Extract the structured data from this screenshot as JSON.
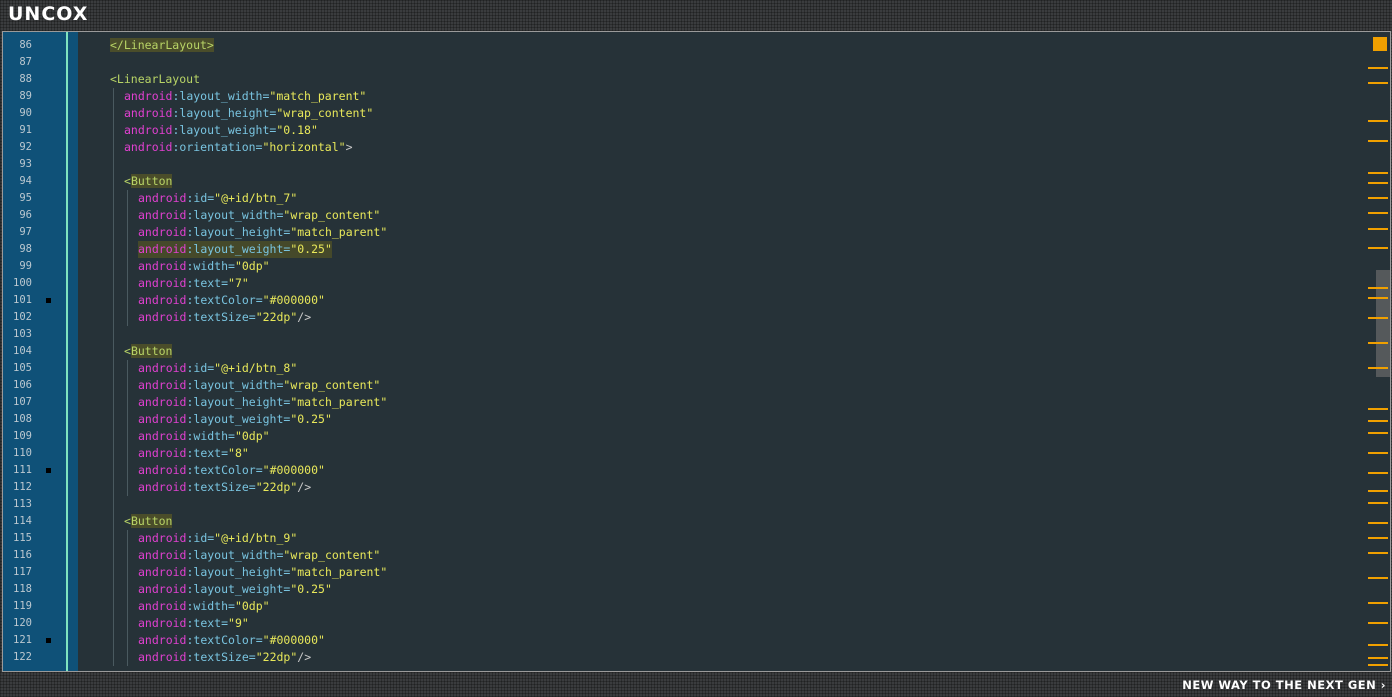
{
  "app": {
    "logo": "UNCOX",
    "tagline": "NEW WAY TO THE NEXT GEN ›"
  },
  "editor": {
    "breakpoint_lines": [
      101,
      111,
      121
    ],
    "lines": [
      {
        "n": "86",
        "indent": 0,
        "tokens": [
          {
            "t": "</LinearLayout>",
            "c": "tt",
            "hl": true
          }
        ]
      },
      {
        "n": "87",
        "indent": 0,
        "tokens": []
      },
      {
        "n": "88",
        "indent": 0,
        "tokens": [
          {
            "t": "<LinearLayout",
            "c": "tt"
          }
        ]
      },
      {
        "n": "89",
        "indent": 1,
        "tokens": [
          {
            "t": "android",
            "c": "ta"
          },
          {
            "t": ":layout_width=",
            "c": "tb"
          },
          {
            "t": "\"match_parent\"",
            "c": "tv"
          }
        ]
      },
      {
        "n": "90",
        "indent": 1,
        "tokens": [
          {
            "t": "android",
            "c": "ta"
          },
          {
            "t": ":layout_height=",
            "c": "tb"
          },
          {
            "t": "\"wrap_content\"",
            "c": "tv"
          }
        ]
      },
      {
        "n": "91",
        "indent": 1,
        "tokens": [
          {
            "t": "android",
            "c": "ta"
          },
          {
            "t": ":layout_weight=",
            "c": "tb"
          },
          {
            "t": "\"0.18\"",
            "c": "tv"
          }
        ]
      },
      {
        "n": "92",
        "indent": 1,
        "tokens": [
          {
            "t": "android",
            "c": "ta"
          },
          {
            "t": ":orientation=",
            "c": "tb"
          },
          {
            "t": "\"horizontal\"",
            "c": "tv"
          },
          {
            "t": ">",
            "c": "tp"
          }
        ]
      },
      {
        "n": "93",
        "indent": 1,
        "tokens": []
      },
      {
        "n": "94",
        "indent": 1,
        "tokens": [
          {
            "t": "<",
            "c": "tt"
          },
          {
            "t": "Button",
            "c": "tt",
            "hl": true
          }
        ]
      },
      {
        "n": "95",
        "indent": 2,
        "tokens": [
          {
            "t": "android",
            "c": "ta"
          },
          {
            "t": ":id=",
            "c": "tb"
          },
          {
            "t": "\"@+id/btn_7\"",
            "c": "tv"
          }
        ]
      },
      {
        "n": "96",
        "indent": 2,
        "tokens": [
          {
            "t": "android",
            "c": "ta"
          },
          {
            "t": ":layout_width=",
            "c": "tb"
          },
          {
            "t": "\"wrap_content\"",
            "c": "tv"
          }
        ]
      },
      {
        "n": "97",
        "indent": 2,
        "tokens": [
          {
            "t": "android",
            "c": "ta"
          },
          {
            "t": ":layout_height=",
            "c": "tb"
          },
          {
            "t": "\"match_parent\"",
            "c": "tv"
          }
        ]
      },
      {
        "n": "98",
        "indent": 2,
        "rowhl": true,
        "tokens": [
          {
            "t": "android",
            "c": "ta"
          },
          {
            "t": ":layout_weight=",
            "c": "tb"
          },
          {
            "t": "\"0.25\"",
            "c": "tv"
          }
        ]
      },
      {
        "n": "99",
        "indent": 2,
        "tokens": [
          {
            "t": "android",
            "c": "ta"
          },
          {
            "t": ":width=",
            "c": "tb"
          },
          {
            "t": "\"0dp\"",
            "c": "tv"
          }
        ]
      },
      {
        "n": "100",
        "indent": 2,
        "tokens": [
          {
            "t": "android",
            "c": "ta"
          },
          {
            "t": ":text=",
            "c": "tb"
          },
          {
            "t": "\"7\"",
            "c": "tv"
          }
        ]
      },
      {
        "n": "101",
        "indent": 2,
        "tokens": [
          {
            "t": "android",
            "c": "ta"
          },
          {
            "t": ":textColor=",
            "c": "tb"
          },
          {
            "t": "\"#000000\"",
            "c": "tv"
          }
        ]
      },
      {
        "n": "102",
        "indent": 2,
        "tokens": [
          {
            "t": "android",
            "c": "ta"
          },
          {
            "t": ":textSize=",
            "c": "tb"
          },
          {
            "t": "\"22dp\"",
            "c": "tv"
          },
          {
            "t": "/>",
            "c": "tp"
          }
        ]
      },
      {
        "n": "103",
        "indent": 1,
        "tokens": []
      },
      {
        "n": "104",
        "indent": 1,
        "tokens": [
          {
            "t": "<",
            "c": "tt"
          },
          {
            "t": "Button",
            "c": "tt",
            "hl": true
          }
        ]
      },
      {
        "n": "105",
        "indent": 2,
        "tokens": [
          {
            "t": "android",
            "c": "ta"
          },
          {
            "t": ":id=",
            "c": "tb"
          },
          {
            "t": "\"@+id/btn_8\"",
            "c": "tv"
          }
        ]
      },
      {
        "n": "106",
        "indent": 2,
        "tokens": [
          {
            "t": "android",
            "c": "ta"
          },
          {
            "t": ":layout_width=",
            "c": "tb"
          },
          {
            "t": "\"wrap_content\"",
            "c": "tv"
          }
        ]
      },
      {
        "n": "107",
        "indent": 2,
        "tokens": [
          {
            "t": "android",
            "c": "ta"
          },
          {
            "t": ":layout_height=",
            "c": "tb"
          },
          {
            "t": "\"match_parent\"",
            "c": "tv"
          }
        ]
      },
      {
        "n": "108",
        "indent": 2,
        "tokens": [
          {
            "t": "android",
            "c": "ta"
          },
          {
            "t": ":layout_weight=",
            "c": "tb"
          },
          {
            "t": "\"0.25\"",
            "c": "tv"
          }
        ]
      },
      {
        "n": "109",
        "indent": 2,
        "tokens": [
          {
            "t": "android",
            "c": "ta"
          },
          {
            "t": ":width=",
            "c": "tb"
          },
          {
            "t": "\"0dp\"",
            "c": "tv"
          }
        ]
      },
      {
        "n": "110",
        "indent": 2,
        "tokens": [
          {
            "t": "android",
            "c": "ta"
          },
          {
            "t": ":text=",
            "c": "tb"
          },
          {
            "t": "\"8\"",
            "c": "tv"
          }
        ]
      },
      {
        "n": "111",
        "indent": 2,
        "tokens": [
          {
            "t": "android",
            "c": "ta"
          },
          {
            "t": ":textColor=",
            "c": "tb"
          },
          {
            "t": "\"#000000\"",
            "c": "tv"
          }
        ]
      },
      {
        "n": "112",
        "indent": 2,
        "tokens": [
          {
            "t": "android",
            "c": "ta"
          },
          {
            "t": ":textSize=",
            "c": "tb"
          },
          {
            "t": "\"22dp\"",
            "c": "tv"
          },
          {
            "t": "/>",
            "c": "tp"
          }
        ]
      },
      {
        "n": "113",
        "indent": 1,
        "tokens": []
      },
      {
        "n": "114",
        "indent": 1,
        "tokens": [
          {
            "t": "<",
            "c": "tt"
          },
          {
            "t": "Button",
            "c": "tt",
            "hl": true
          }
        ]
      },
      {
        "n": "115",
        "indent": 2,
        "tokens": [
          {
            "t": "android",
            "c": "ta"
          },
          {
            "t": ":id=",
            "c": "tb"
          },
          {
            "t": "\"@+id/btn_9\"",
            "c": "tv"
          }
        ]
      },
      {
        "n": "116",
        "indent": 2,
        "tokens": [
          {
            "t": "android",
            "c": "ta"
          },
          {
            "t": ":layout_width=",
            "c": "tb"
          },
          {
            "t": "\"wrap_content\"",
            "c": "tv"
          }
        ]
      },
      {
        "n": "117",
        "indent": 2,
        "tokens": [
          {
            "t": "android",
            "c": "ta"
          },
          {
            "t": ":layout_height=",
            "c": "tb"
          },
          {
            "t": "\"match_parent\"",
            "c": "tv"
          }
        ]
      },
      {
        "n": "118",
        "indent": 2,
        "tokens": [
          {
            "t": "android",
            "c": "ta"
          },
          {
            "t": ":layout_weight=",
            "c": "tb"
          },
          {
            "t": "\"0.25\"",
            "c": "tv"
          }
        ]
      },
      {
        "n": "119",
        "indent": 2,
        "tokens": [
          {
            "t": "android",
            "c": "ta"
          },
          {
            "t": ":width=",
            "c": "tb"
          },
          {
            "t": "\"0dp\"",
            "c": "tv"
          }
        ]
      },
      {
        "n": "120",
        "indent": 2,
        "tokens": [
          {
            "t": "android",
            "c": "ta"
          },
          {
            "t": ":text=",
            "c": "tb"
          },
          {
            "t": "\"9\"",
            "c": "tv"
          }
        ]
      },
      {
        "n": "121",
        "indent": 2,
        "tokens": [
          {
            "t": "android",
            "c": "ta"
          },
          {
            "t": ":textColor=",
            "c": "tb"
          },
          {
            "t": "\"#000000\"",
            "c": "tv"
          }
        ]
      },
      {
        "n": "122",
        "indent": 2,
        "tokens": [
          {
            "t": "android",
            "c": "ta"
          },
          {
            "t": ":textSize=",
            "c": "tb"
          },
          {
            "t": "\"22dp\"",
            "c": "tv"
          },
          {
            "t": "/>",
            "c": "tp"
          }
        ]
      }
    ]
  },
  "colors": {
    "editor_bg": "#263238",
    "gutter_bg": "#0f5178",
    "fold_line": "#7fe3c0",
    "attr_prefix": "#e040d0",
    "attr_name": "#79c4e0",
    "attr_value": "#e8e85a",
    "tag": "#b8d466",
    "marker": "#f0a000"
  }
}
